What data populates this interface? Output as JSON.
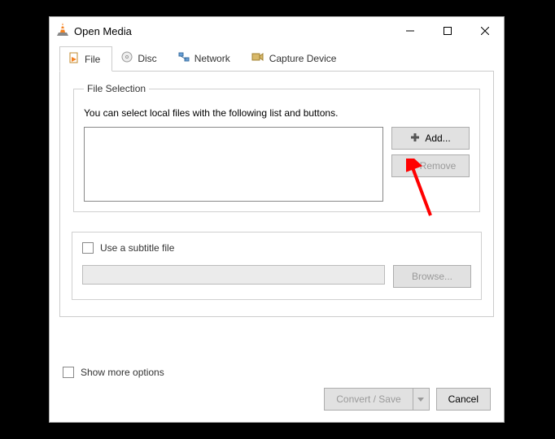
{
  "title": "Open Media",
  "tabs": [
    {
      "label": "File",
      "icon": "file-icon"
    },
    {
      "label": "Disc",
      "icon": "disc-icon"
    },
    {
      "label": "Network",
      "icon": "network-icon"
    },
    {
      "label": "Capture Device",
      "icon": "capture-icon"
    }
  ],
  "group_title": "File Selection",
  "help_text": "You can select local files with the following list and buttons.",
  "buttons": {
    "add": "Add...",
    "remove": "Remove",
    "browse": "Browse...",
    "convert": "Convert / Save",
    "cancel": "Cancel"
  },
  "subtitle": {
    "label": "Use a subtitle file"
  },
  "show_more": "Show more options"
}
